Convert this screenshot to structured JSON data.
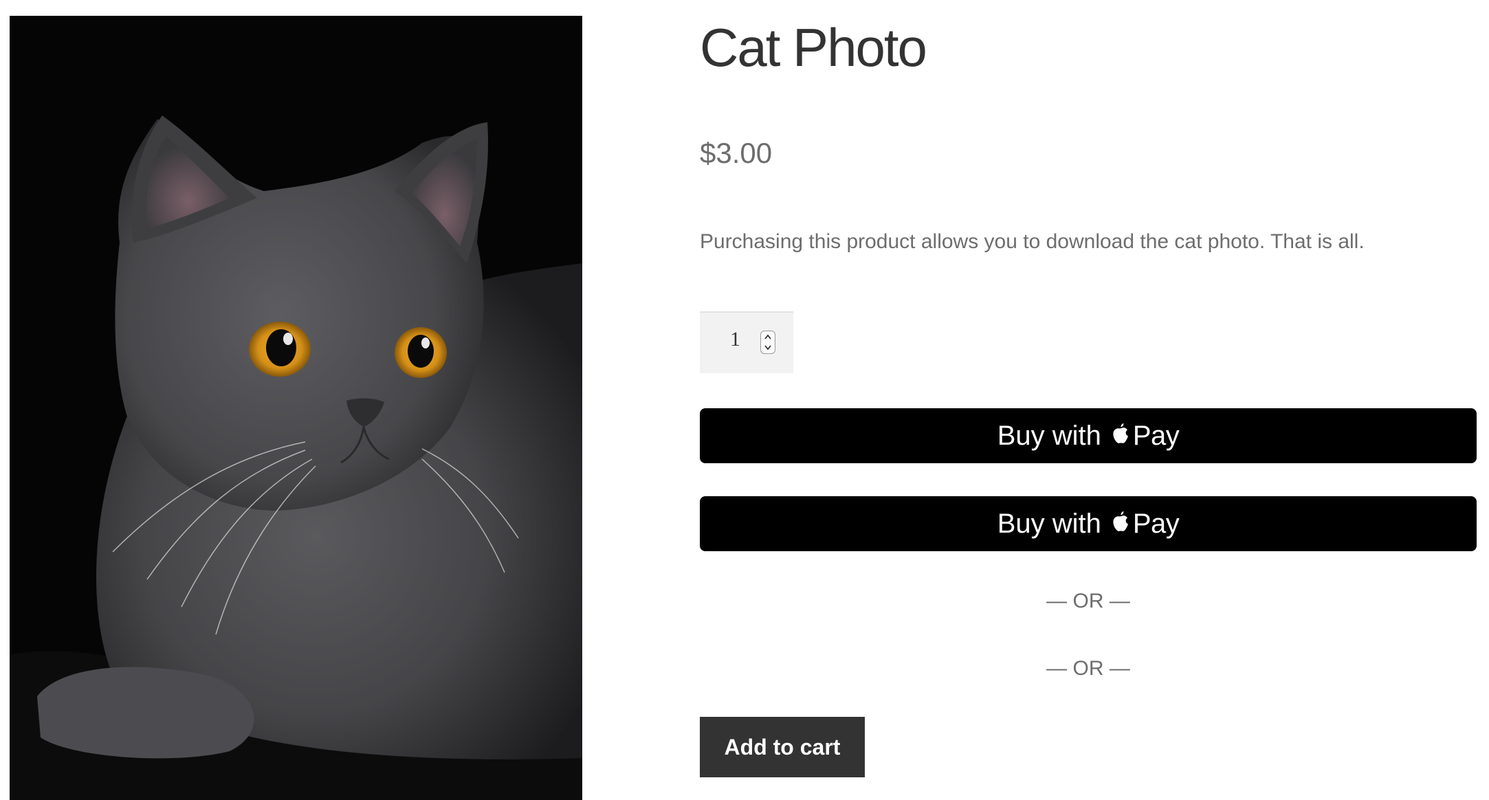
{
  "product": {
    "title": "Cat Photo",
    "price": "$3.00",
    "description": "Purchasing this product allows you to download the cat photo. That is all.",
    "image_subject": "gray cat with amber eyes on black background"
  },
  "quantity": {
    "value": "1"
  },
  "payment_buttons": [
    {
      "label": "Buy with",
      "brand_word": "Pay",
      "icon": "apple-icon"
    },
    {
      "label": "Buy with",
      "brand_word": "Pay",
      "icon": "apple-icon"
    }
  ],
  "separators": [
    "— OR —",
    "— OR —"
  ],
  "add_to_cart": {
    "label": "Add to cart"
  },
  "colors": {
    "pay_button_bg": "#000000",
    "add_to_cart_bg": "#333333",
    "title_text": "#333333",
    "muted_text": "#6d6d6d",
    "qty_bg": "#f2f2f2"
  }
}
